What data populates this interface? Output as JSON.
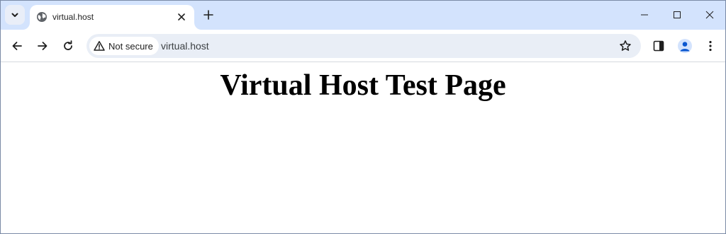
{
  "browser": {
    "tab": {
      "title": "virtual.host",
      "favicon": "globe-icon"
    },
    "address_bar": {
      "security_label": "Not secure",
      "url": "virtual.host"
    },
    "colors": {
      "tabstrip": "#d3e3fd",
      "omnibox": "#e9eef6",
      "accent": "#0b57d0"
    }
  },
  "page": {
    "heading": "Virtual Host Test Page"
  }
}
